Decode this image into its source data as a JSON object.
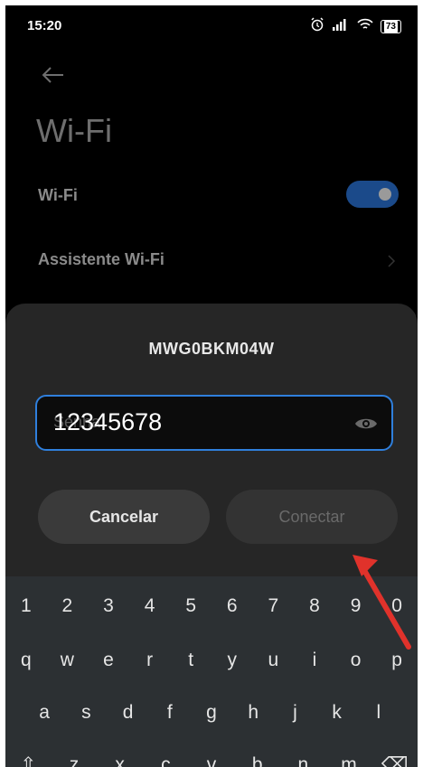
{
  "status_bar": {
    "time": "15:20",
    "battery": "73"
  },
  "page": {
    "title": "Wi-Fi",
    "wifi_row": {
      "label": "Wi-Fi",
      "toggle_on": true
    },
    "assistant_row": {
      "label": "Assistente Wi-Fi"
    }
  },
  "dialog": {
    "ssid": "MWG0BKM04W",
    "password": {
      "value": "12345678",
      "hint": "Senha"
    },
    "cancel_label": "Cancelar",
    "connect_label": "Conectar"
  },
  "keyboard": {
    "row1": [
      "1",
      "2",
      "3",
      "4",
      "5",
      "6",
      "7",
      "8",
      "9",
      "0"
    ],
    "row2": [
      "q",
      "w",
      "e",
      "r",
      "t",
      "y",
      "u",
      "i",
      "o",
      "p"
    ],
    "row3": [
      "a",
      "s",
      "d",
      "f",
      "g",
      "h",
      "j",
      "k",
      "l"
    ],
    "row4": [
      "⇧",
      "z",
      "x",
      "c",
      "v",
      "b",
      "n",
      "m",
      "⌫"
    ]
  },
  "colors": {
    "accent": "#2f7fdc",
    "annotation_arrow": "#e0322b"
  }
}
